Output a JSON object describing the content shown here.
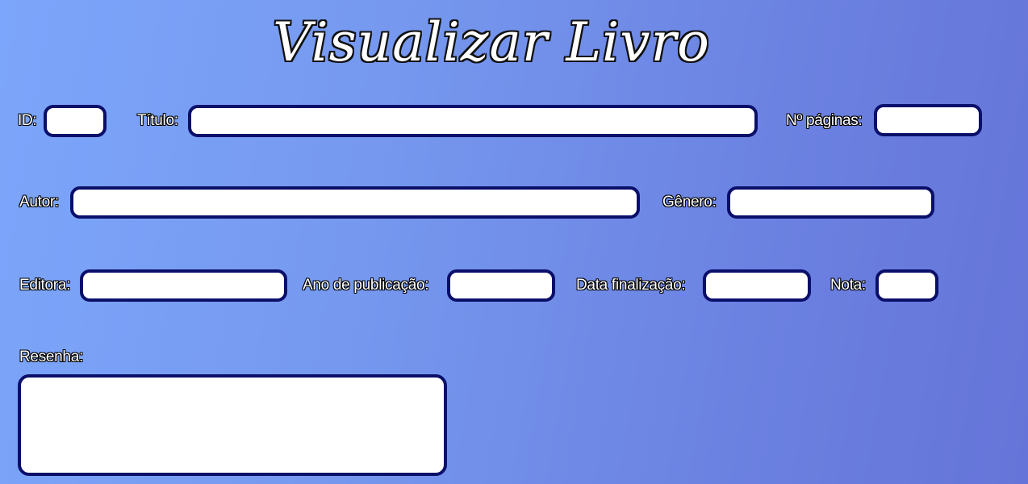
{
  "page": {
    "title": "Visualizar Livro"
  },
  "form": {
    "id": {
      "label": "ID:",
      "value": ""
    },
    "titulo": {
      "label": "Título:",
      "value": ""
    },
    "paginas": {
      "label": "Nº páginas:",
      "value": ""
    },
    "autor": {
      "label": "Autor:",
      "value": ""
    },
    "genero": {
      "label": "Gênero:",
      "value": ""
    },
    "editora": {
      "label": "Editora:",
      "value": ""
    },
    "ano_publicacao": {
      "label": "Ano de publicação:",
      "value": ""
    },
    "data_finalizacao": {
      "label": "Data finalização:",
      "value": ""
    },
    "nota": {
      "label": "Nota:",
      "value": ""
    },
    "resenha": {
      "label": "Resenha:",
      "value": ""
    }
  },
  "colors": {
    "background_start": "#7ca6fb",
    "background_end": "#6574d8",
    "field_border": "#0a0f6a",
    "field_fill": "#ffffff",
    "label_text": "#ffffff"
  }
}
